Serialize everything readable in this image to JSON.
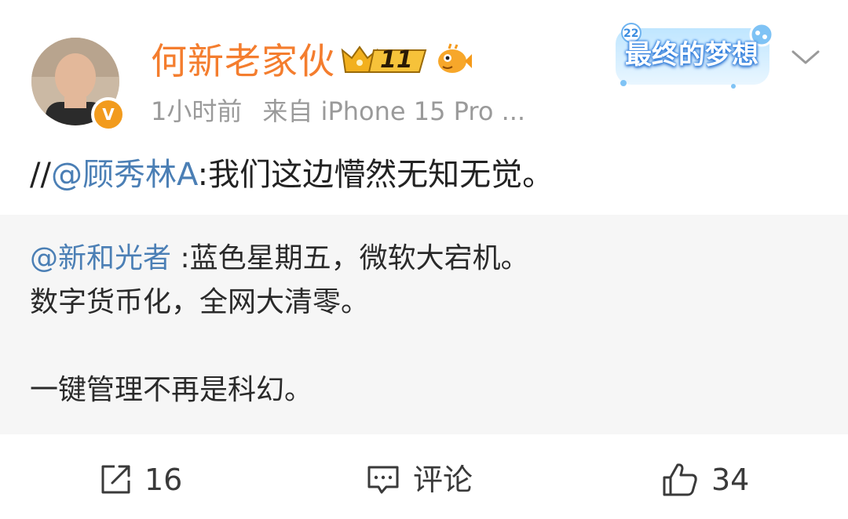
{
  "header": {
    "username": "何新老家伙",
    "vip_level": "11",
    "time": "1小时前",
    "source": "来自 iPhone 15 Pro ...",
    "skin_card_text": "最终的梦想",
    "verified_mark": "V"
  },
  "repost": {
    "prefix": "//",
    "mention": "@顾秀林A",
    "text": ":我们这边懵然无知无觉。"
  },
  "quoted": {
    "mention": "@新和光者",
    "line1": " :蓝色星期五，微软大宕机。",
    "line2": "数字货币化，全网大清零。",
    "line3": "一键管理不再是科幻。"
  },
  "actions": {
    "share_count": "16",
    "comment_label": "评论",
    "like_count": "34"
  },
  "colors": {
    "username": "#f47d2e",
    "mention": "#4b7fb5",
    "meta": "#9a9a9a",
    "quoted_bg": "#f6f6f6"
  }
}
